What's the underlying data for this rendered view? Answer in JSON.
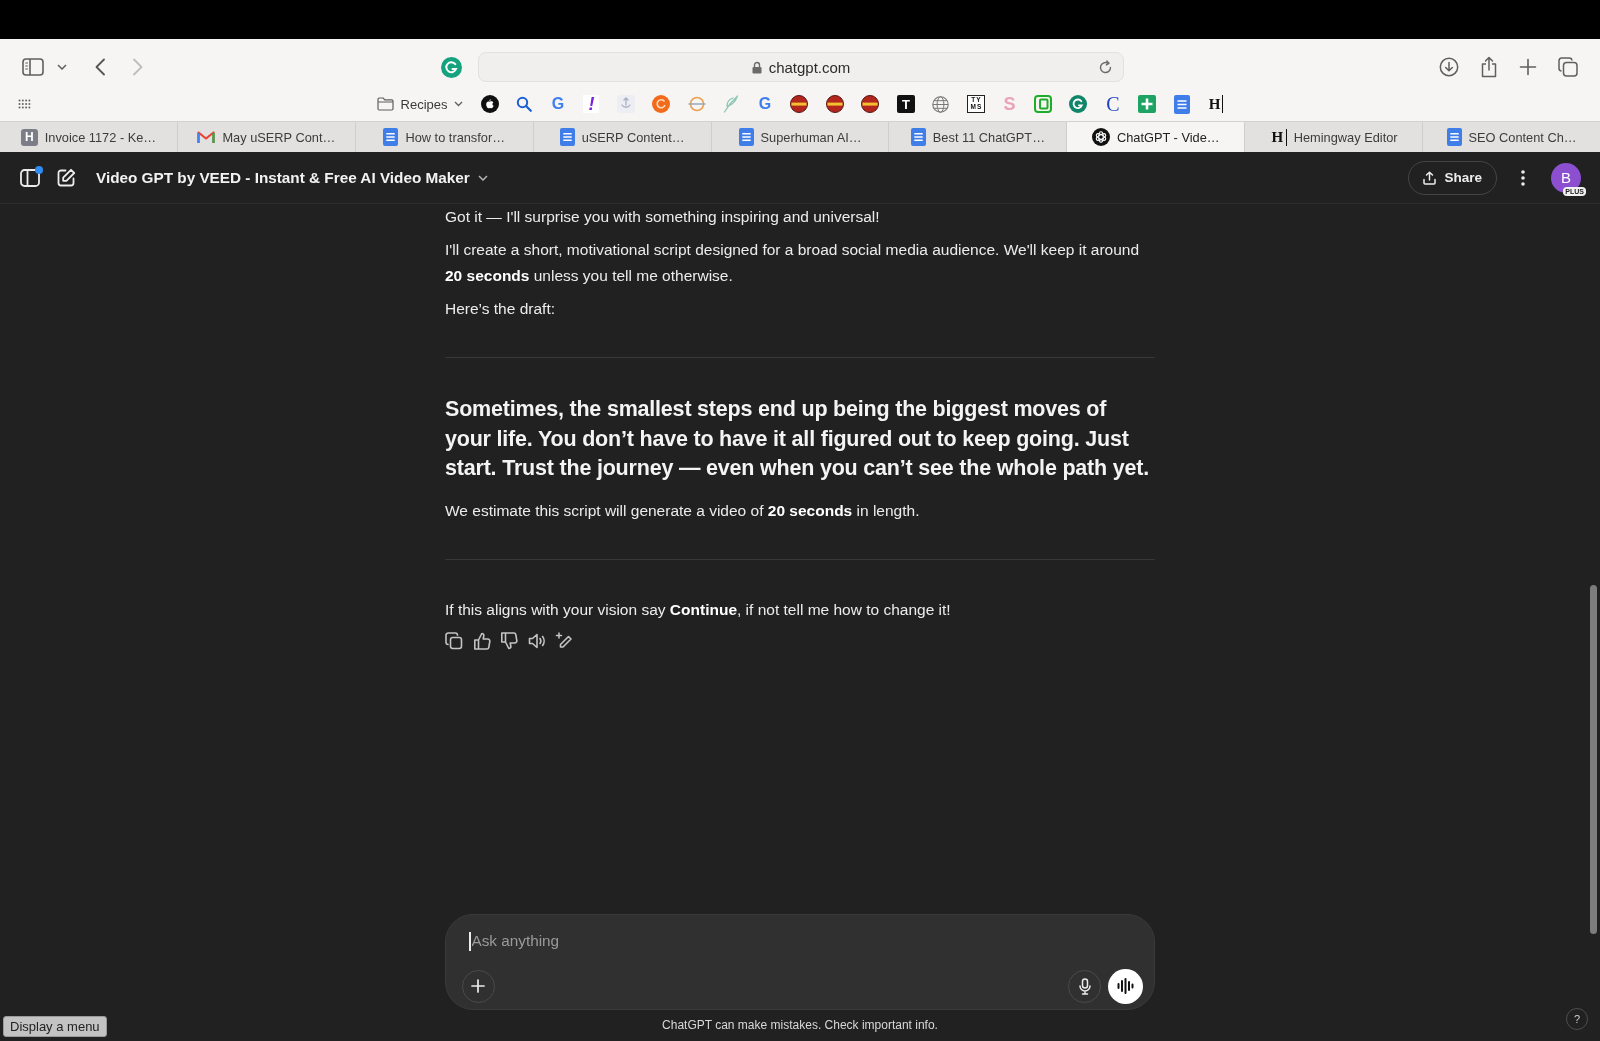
{
  "browser_toolbar": {
    "nav": [
      {
        "kind": "back",
        "disabled": false
      },
      {
        "kind": "forward",
        "disabled": true
      }
    ],
    "address": "chatgpt.com"
  },
  "bookmarks_bar": {
    "items": [
      {
        "kind": "folder",
        "label": "Recipes"
      },
      {
        "kind": "apple"
      },
      {
        "kind": "magnifier"
      },
      {
        "kind": "g-letter",
        "glyph": "G"
      },
      {
        "kind": "bang-letter",
        "glyph": "!"
      },
      {
        "kind": "sketch"
      },
      {
        "kind": "swirl-disc"
      },
      {
        "kind": "struck-ring"
      },
      {
        "kind": "feather"
      },
      {
        "kind": "g-letter",
        "glyph": "G"
      },
      {
        "kind": "striped-disc"
      },
      {
        "kind": "striped-disc"
      },
      {
        "kind": "striped-disc"
      },
      {
        "kind": "tile-letter",
        "glyph": "T"
      },
      {
        "kind": "globe"
      },
      {
        "kind": "boxed-letter",
        "glyph": "TYMS"
      },
      {
        "kind": "pastel-letter",
        "glyph": "S"
      },
      {
        "kind": "nested-squares"
      },
      {
        "kind": "arc-disc"
      },
      {
        "kind": "serif-letter",
        "glyph": "C"
      },
      {
        "kind": "plus-tile"
      },
      {
        "kind": "doc"
      },
      {
        "kind": "serif-bar-letter",
        "glyph": "H"
      }
    ]
  },
  "tabs": [
    {
      "label": "Invoice 1172 - Ke…",
      "kind": "letter-tile",
      "glyph": "H",
      "selected": false
    },
    {
      "label": "May uSERP Cont…",
      "kind": "envelope",
      "selected": false
    },
    {
      "label": "How to transfor…",
      "kind": "doc",
      "selected": false
    },
    {
      "label": "uSERP Content…",
      "kind": "doc",
      "selected": false
    },
    {
      "label": "Superhuman AI…",
      "kind": "doc",
      "selected": false
    },
    {
      "label": "Best 11 ChatGPT…",
      "kind": "doc",
      "selected": false
    },
    {
      "label": "ChatGPT - Vide…",
      "kind": "knot",
      "selected": true
    },
    {
      "label": "Hemingway Editor",
      "kind": "serif-bar-letter",
      "glyph": "H",
      "selected": false
    },
    {
      "label": "SEO Content Ch…",
      "kind": "doc",
      "selected": false
    }
  ],
  "chat_header": {
    "title": "Video GPT by VEED - Instant & Free AI Video Maker",
    "sidebar_dot": true,
    "share_label": "Share",
    "avatar": {
      "initial": "B",
      "badge": "PLUS"
    }
  },
  "conversation": {
    "blocks": [
      {
        "kind": "paragraph",
        "text": "Got it — I'll surprise you with something inspiring and universal!"
      },
      {
        "kind": "paragraph",
        "text": "I'll create a short, motivational script designed for a broad social media audience. We'll keep it around **20 seconds** unless you tell me otherwise."
      },
      {
        "kind": "paragraph",
        "text": "Here’s the draft:"
      },
      {
        "kind": "divider"
      },
      {
        "kind": "heading",
        "text": "Sometimes, the smallest steps end up being the biggest moves of your life. You don’t have to have it all figured out to keep going. Just start. Trust the journey — even when you can’t see the whole path yet."
      },
      {
        "kind": "paragraph",
        "text": "We estimate this script will generate a video of **20 seconds** in length."
      },
      {
        "kind": "divider"
      },
      {
        "kind": "paragraph",
        "text": "If this aligns with your vision say **Continue**, if not tell me how to change it!"
      }
    ],
    "actions": [
      {
        "kind": "copy"
      },
      {
        "kind": "thumbs-up"
      },
      {
        "kind": "thumbs-down"
      },
      {
        "kind": "speaker"
      },
      {
        "kind": "edit-sparkle"
      }
    ]
  },
  "composer": {
    "placeholder": "Ask anything"
  },
  "disclaimer": "ChatGPT can make mistakes. Check important info.",
  "tooltip": "Display a menu",
  "help_label": "?"
}
